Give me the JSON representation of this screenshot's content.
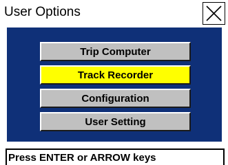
{
  "window": {
    "title": "User Options",
    "close_icon": "close-icon"
  },
  "menu": {
    "items": [
      {
        "label": "Trip Computer",
        "selected": false
      },
      {
        "label": "Track Recorder",
        "selected": true
      },
      {
        "label": "Configuration",
        "selected": false
      },
      {
        "label": "User Setting",
        "selected": false
      }
    ]
  },
  "status": {
    "text": "Press ENTER or ARROW keys"
  },
  "colors": {
    "panel_background": "#0f3078",
    "button_background": "#c0c0c0",
    "selected_button_background": "#ffff00",
    "text": "#000000"
  }
}
